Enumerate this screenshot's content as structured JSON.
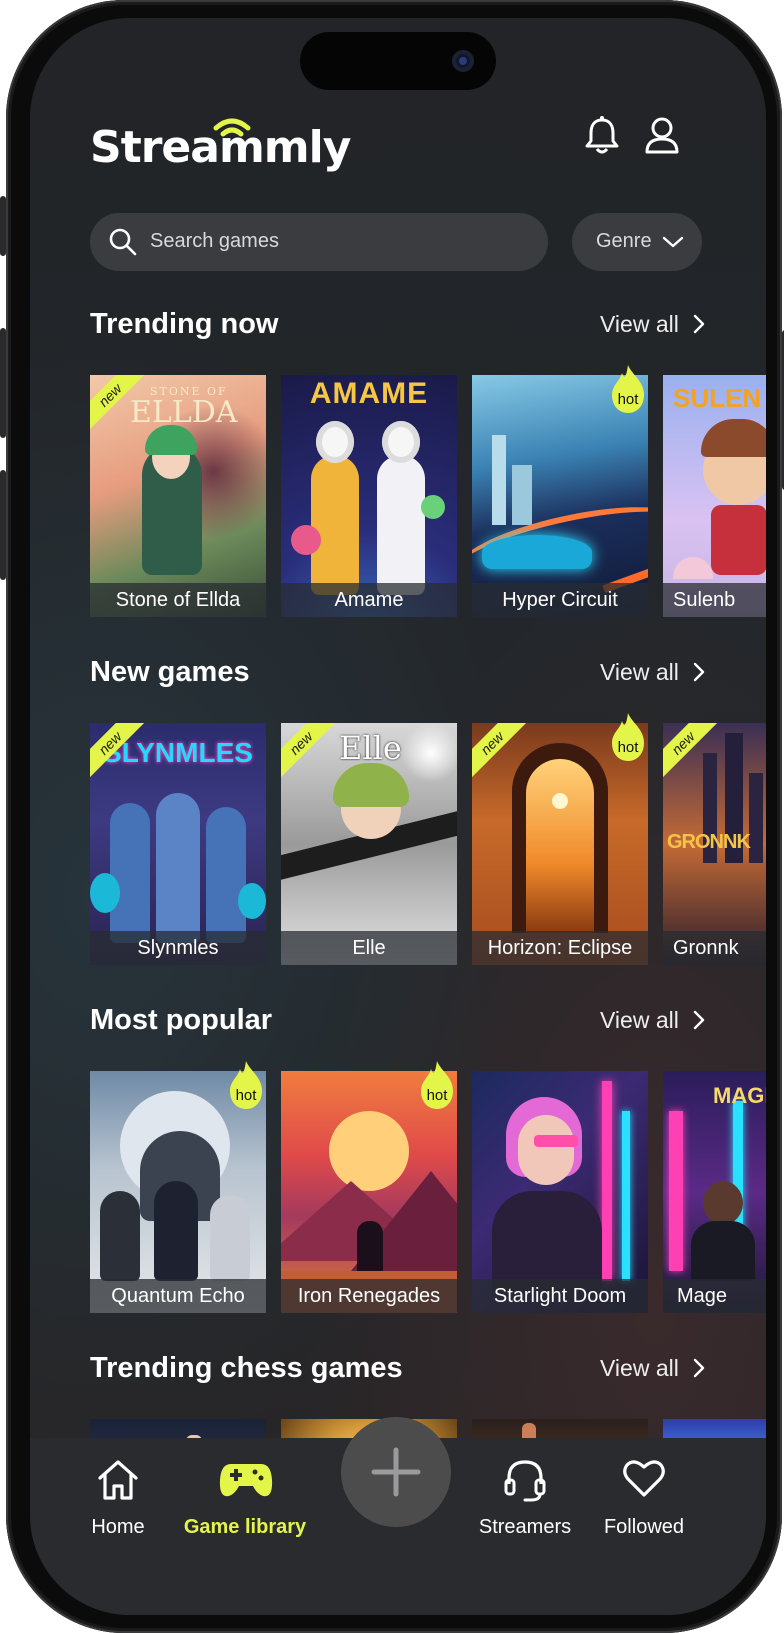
{
  "app": {
    "name": "Streammly"
  },
  "header": {
    "notification_icon": "bell-icon",
    "profile_icon": "user-icon"
  },
  "search": {
    "placeholder": "Search games",
    "icon": "search-icon"
  },
  "genre": {
    "label": "Genre"
  },
  "colors": {
    "accent": "#e4f54a",
    "background": "#232629",
    "card_caption": "#2a2e34"
  },
  "sections": [
    {
      "title": "Trending now",
      "view_all": "View all",
      "games": [
        {
          "title": "Stone of Ellda",
          "badge_new": "new",
          "badge_hot": ""
        },
        {
          "title": "Amame",
          "badge_new": "",
          "badge_hot": ""
        },
        {
          "title": "Hyper Circuit",
          "badge_new": "",
          "badge_hot": "hot"
        },
        {
          "title": "Sulenb",
          "badge_new": "",
          "badge_hot": ""
        }
      ]
    },
    {
      "title": "New games",
      "view_all": "View all",
      "games": [
        {
          "title": "Slynmles",
          "badge_new": "new",
          "badge_hot": ""
        },
        {
          "title": "Elle",
          "badge_new": "new",
          "badge_hot": ""
        },
        {
          "title": "Horizon: Eclipse",
          "badge_new": "new",
          "badge_hot": "hot"
        },
        {
          "title": "Gronnk",
          "badge_new": "new",
          "badge_hot": ""
        }
      ]
    },
    {
      "title": "Most popular",
      "view_all": "View all",
      "games": [
        {
          "title": "Quantum Echo",
          "badge_new": "",
          "badge_hot": "hot"
        },
        {
          "title": "Iron Renegades",
          "badge_new": "",
          "badge_hot": "hot"
        },
        {
          "title": "Starlight Doom",
          "badge_new": "",
          "badge_hot": ""
        },
        {
          "title": "Mage",
          "badge_new": "",
          "badge_hot": ""
        }
      ]
    },
    {
      "title": "Trending chess games",
      "view_all": "View all",
      "games": [
        {
          "title": "",
          "badge_new": "",
          "badge_hot": ""
        },
        {
          "title": "",
          "badge_new": "",
          "badge_hot": ""
        },
        {
          "title": "",
          "badge_new": "",
          "badge_hot": ""
        },
        {
          "title": "",
          "badge_new": "",
          "badge_hot": ""
        }
      ]
    }
  ],
  "cover_text": {
    "stone_of": "STONE OF",
    "ellda": "ELLDA",
    "amame": "AMAME",
    "sulen": "SULEN",
    "slynmles": "SLYNMLES",
    "elle": "Elle",
    "gronnk": "GRONNK",
    "mage": "MAGE"
  },
  "bottom_nav": [
    {
      "label": "Home",
      "icon": "home-icon",
      "active": false
    },
    {
      "label": "Game library",
      "icon": "gamepad-icon",
      "active": true
    },
    {
      "label": "",
      "icon": "plus-icon",
      "active": false
    },
    {
      "label": "Streamers",
      "icon": "headset-icon",
      "active": false
    },
    {
      "label": "Followed",
      "icon": "heart-icon",
      "active": false
    }
  ]
}
